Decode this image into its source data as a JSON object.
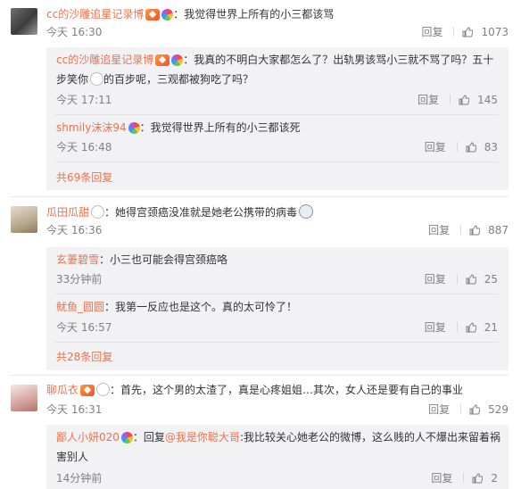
{
  "comments": [
    {
      "user": "cc的沙雕追星记录博",
      "text": "：我觉得世界上所有的小三都该骂",
      "time": "今天 16:30",
      "reply_label": "回复",
      "likes": "1073",
      "subs": [
        {
          "user": "cc的沙雕追星记录博",
          "text_line1": "：我真的不明白大家都怎么了？出轨男该骂小三就不骂了吗？五十",
          "text_line2": "步笑你",
          "text_line2b": "的百步呢，三观都被狗吃了吗？",
          "time": "今天 17:11",
          "reply_label": "回复",
          "likes": "145"
        },
        {
          "user": "shmily沫沫94",
          "text": "：我觉得世界上所有的小三都该死",
          "time": "今天 16:48",
          "reply_label": "回复",
          "likes": "83"
        }
      ],
      "more": "共69条回复"
    },
    {
      "user": "瓜田瓜甜",
      "text": "：她得宫颈癌没准就是她老公携带的病毒",
      "time": "今天 16:36",
      "reply_label": "回复",
      "likes": "887",
      "subs": [
        {
          "user": "玄萋碧雪",
          "text": "：小三也可能会得宫颈癌咯",
          "time": "33分钟前",
          "reply_label": "回复",
          "likes": "25"
        },
        {
          "user": "鱿鱼_圆圆",
          "text": "：我第一反应也是这个。真的太可怜了！",
          "time": "今天 16:57",
          "reply_label": "回复",
          "likes": "21"
        }
      ],
      "more": "共28条回复"
    },
    {
      "user": "聊瓜衣",
      "text": "：首先，这个男的太渣了，真是心疼姐姐…其次，女人还是要有自己的事业",
      "time": "今天 16:31",
      "reply_label": "回复",
      "likes": "529",
      "subs": [
        {
          "user": "鄙人小妍020",
          "text_prefix": "：回复",
          "mention": "@我是你聪大哥",
          "text_line1": ":我比较关心她老公的微博，这么贱的人不爆出来留着祸",
          "text_line2": "害别人",
          "time": "14分钟前",
          "reply_label": "回复",
          "likes": "2"
        }
      ]
    }
  ],
  "colors": {
    "username": "#eb7350",
    "meta": "#808080",
    "sub_bg": "#f2f2f5"
  },
  "icons": [
    "vip-badge",
    "rainbow-badge",
    "bear-emoji",
    "rabbit-badge",
    "panda-emoji",
    "like-icon"
  ]
}
